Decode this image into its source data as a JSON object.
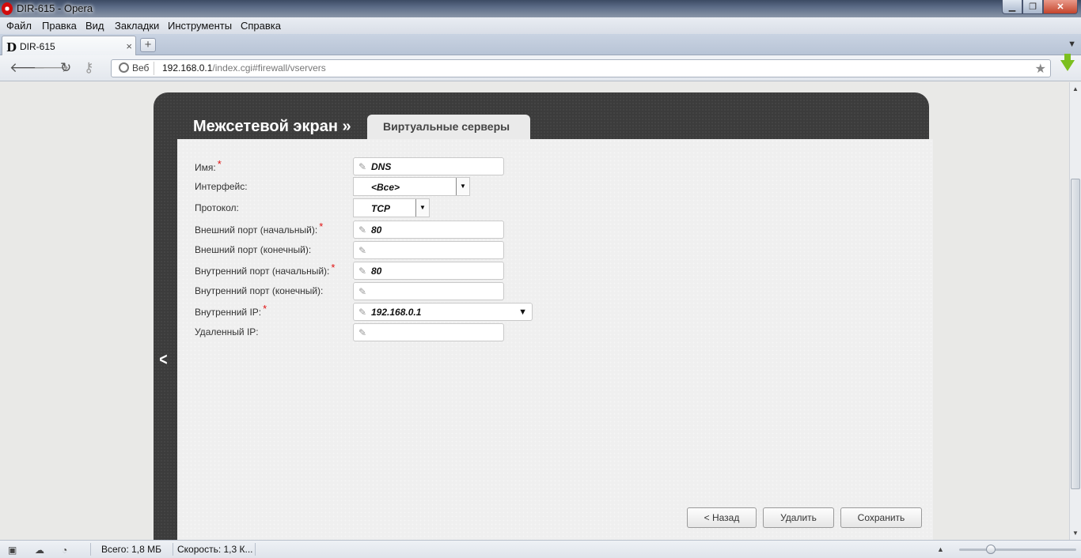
{
  "window": {
    "title": "DIR-615 - Opera",
    "min_icon": "minimize-icon",
    "max_icon": "restore-icon",
    "close_icon": "close-icon"
  },
  "menu": [
    "Файл",
    "Правка",
    "Вид",
    "Закладки",
    "Инструменты",
    "Справка"
  ],
  "tab": {
    "label": "DIR-615",
    "logo": "D",
    "close": "×"
  },
  "address": {
    "web_label": "Веб",
    "host": "192.168.0.1",
    "path": "/index.cgi#firewall/vservers"
  },
  "page": {
    "heading": "Межсетевой экран »",
    "tab_label": "Виртуальные серверы",
    "fields": {
      "name_label": "Имя:",
      "name_value": "DNS",
      "interface_label": "Интерфейс:",
      "interface_value": "<Все>",
      "protocol_label": "Протокол:",
      "protocol_value": "TCP",
      "ext_port_start_label": "Внешний порт (начальный):",
      "ext_port_start_value": "80",
      "ext_port_end_label": "Внешний порт (конечный):",
      "ext_port_end_value": "",
      "int_port_start_label": "Внутренний порт (начальный):",
      "int_port_start_value": "80",
      "int_port_end_label": "Внутренний порт (конечный):",
      "int_port_end_value": "",
      "int_ip_label": "Внутренний IP:",
      "int_ip_value": "192.168.0.1",
      "remote_ip_label": "Удаленный IP:",
      "remote_ip_value": ""
    },
    "required_mark": "*",
    "buttons": {
      "back": "< Назад",
      "delete": "Удалить",
      "save": "Сохранить"
    }
  },
  "status": {
    "total": "Всего:  1,8 МБ",
    "speed": "Скорость:   1,3 К..."
  },
  "colors": {
    "panel": "#3c3c3c",
    "content": "#efefef",
    "required": "#e01010",
    "download": "#7cbf1f"
  }
}
